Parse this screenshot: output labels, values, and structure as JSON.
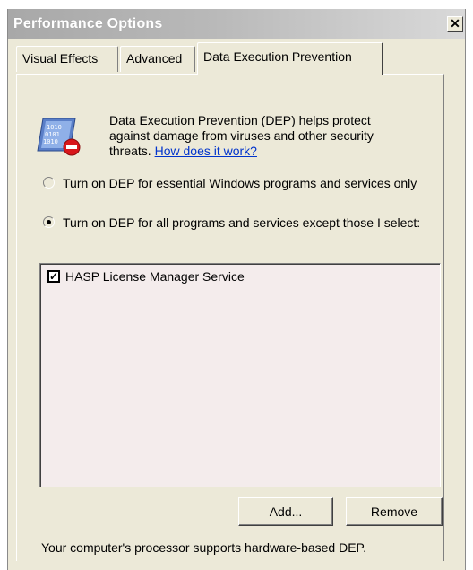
{
  "window": {
    "title": "Performance Options",
    "close_glyph": "✕"
  },
  "tabs": [
    {
      "label": "Visual Effects",
      "active": false
    },
    {
      "label": "Advanced",
      "active": false
    },
    {
      "label": "Data Execution Prevention",
      "active": true
    }
  ],
  "dep": {
    "icon": "dep-shield-icon",
    "description": "Data Execution Prevention (DEP) helps protect against damage from viruses and other security threats.",
    "link_label": "How does it work?"
  },
  "options": [
    {
      "label": "Turn on DEP for essential Windows programs and services only",
      "checked": false
    },
    {
      "label": "Turn on DEP for all programs and services except those I select:",
      "checked": true
    }
  ],
  "exceptions": {
    "items": [
      {
        "label": "HASP License Manager Service",
        "checked": true
      }
    ]
  },
  "buttons": {
    "add_label": "Add...",
    "remove_label": "Remove"
  },
  "status_text": "Your computer's processor supports hardware-based DEP.",
  "colors": {
    "dialog_bg": "#ece9d8",
    "list_bg": "#f4ecec",
    "link": "#0033cc"
  }
}
